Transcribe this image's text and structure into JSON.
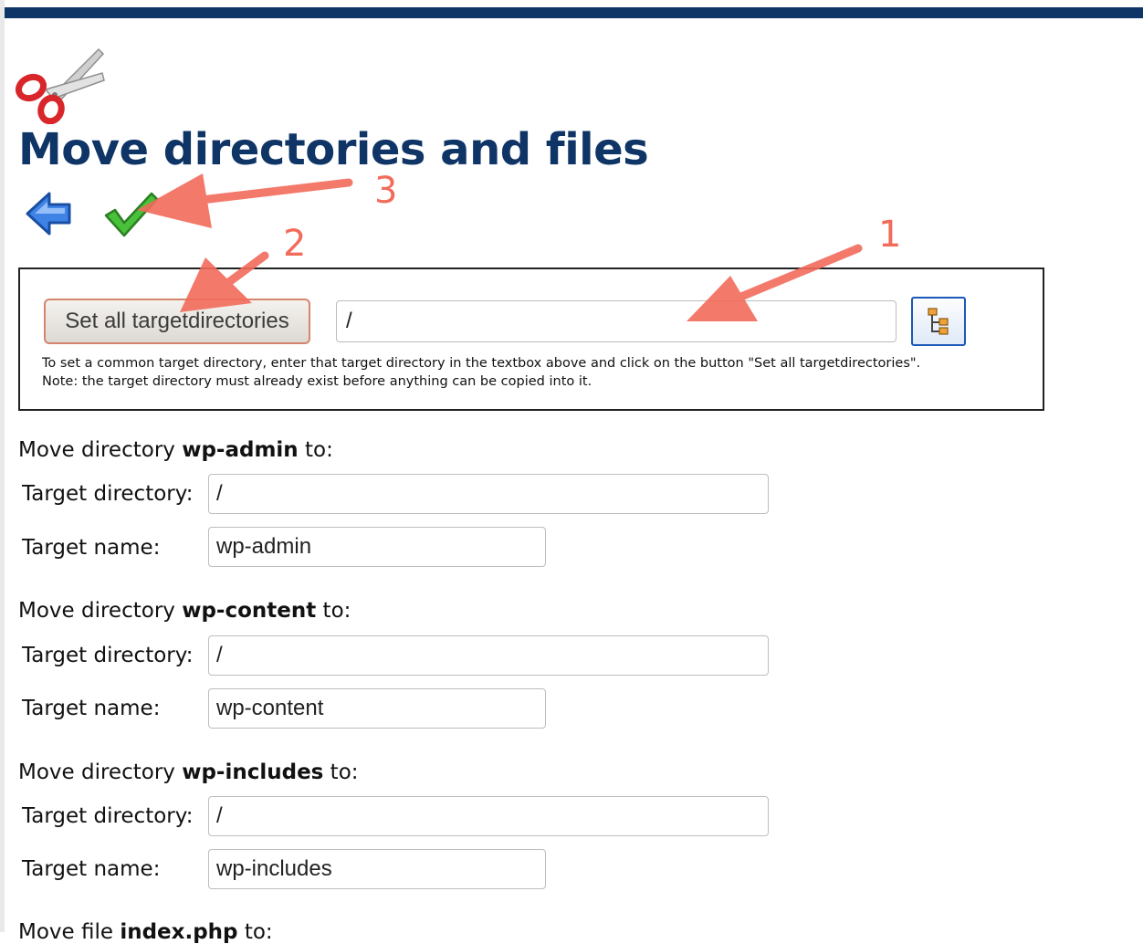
{
  "page": {
    "title": "Move directories and files"
  },
  "toolbar": {
    "back_icon": "arrow-left-icon",
    "confirm_icon": "checkmark-icon"
  },
  "target_box": {
    "set_all_label": "Set all targetdirectories",
    "common_target_value": "/",
    "browse_icon": "folder-tree-icon",
    "hint_line1": "To set a common target directory, enter that target directory in the textbox above and click on the button \"Set all targetdirectories\".",
    "hint_line2": "Note: the target directory must already exist before anything can be copied into it."
  },
  "labels": {
    "target_directory": "Target directory:",
    "target_name": "Target name:"
  },
  "items": [
    {
      "prefix": "Move directory ",
      "name": "wp-admin",
      "suffix": " to:",
      "target_dir": "/",
      "target_name": "wp-admin"
    },
    {
      "prefix": "Move directory ",
      "name": "wp-content",
      "suffix": " to:",
      "target_dir": "/",
      "target_name": "wp-content"
    },
    {
      "prefix": "Move directory ",
      "name": "wp-includes",
      "suffix": " to:",
      "target_dir": "/",
      "target_name": "wp-includes"
    },
    {
      "prefix": "Move file ",
      "name": "index.php",
      "suffix": " to:"
    }
  ],
  "annotations": {
    "labels": [
      "1",
      "2",
      "3"
    ],
    "color": "#f26b5b"
  },
  "colors": {
    "title": "#0f3466",
    "top_bar": "#0f3466",
    "button_border": "#d4866d",
    "browse_border": "#1c58b8"
  }
}
